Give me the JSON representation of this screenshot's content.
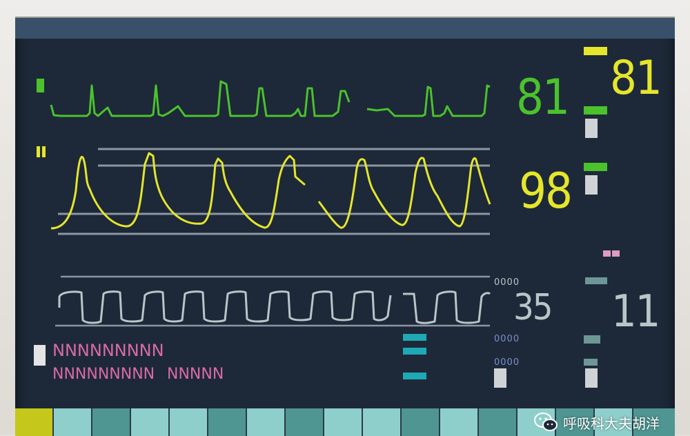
{
  "ecg": {
    "heart_rate": "81",
    "heart_rate_alt": "81",
    "color": "#4bc22c",
    "alt_color": "#e5e62b"
  },
  "spo2": {
    "value": "98",
    "color": "#e5e62b"
  },
  "resp": {
    "value": "35",
    "rate": "11",
    "color": "#b9c6c8"
  },
  "labels": {
    "zeros_1": "0000",
    "zeros_2": "0000",
    "zeros_3": "0000",
    "pink_line_1": "NNNNNNNNN",
    "pink_line_2a": "NNNNNNNNN",
    "pink_line_2b": "NNNNN"
  },
  "watermark": {
    "text": "呼吸科大夫胡洋",
    "icon": "wechat-icon"
  },
  "colors": {
    "screen_bg": "#1d2938",
    "top_bar": "#38506a",
    "tab_light": "#8fcfcb",
    "tab_dark": "#4f9592",
    "tab_accent": "#c5c81a",
    "teal_marker": "#1ea9b4",
    "pink": "#d96aa8"
  }
}
